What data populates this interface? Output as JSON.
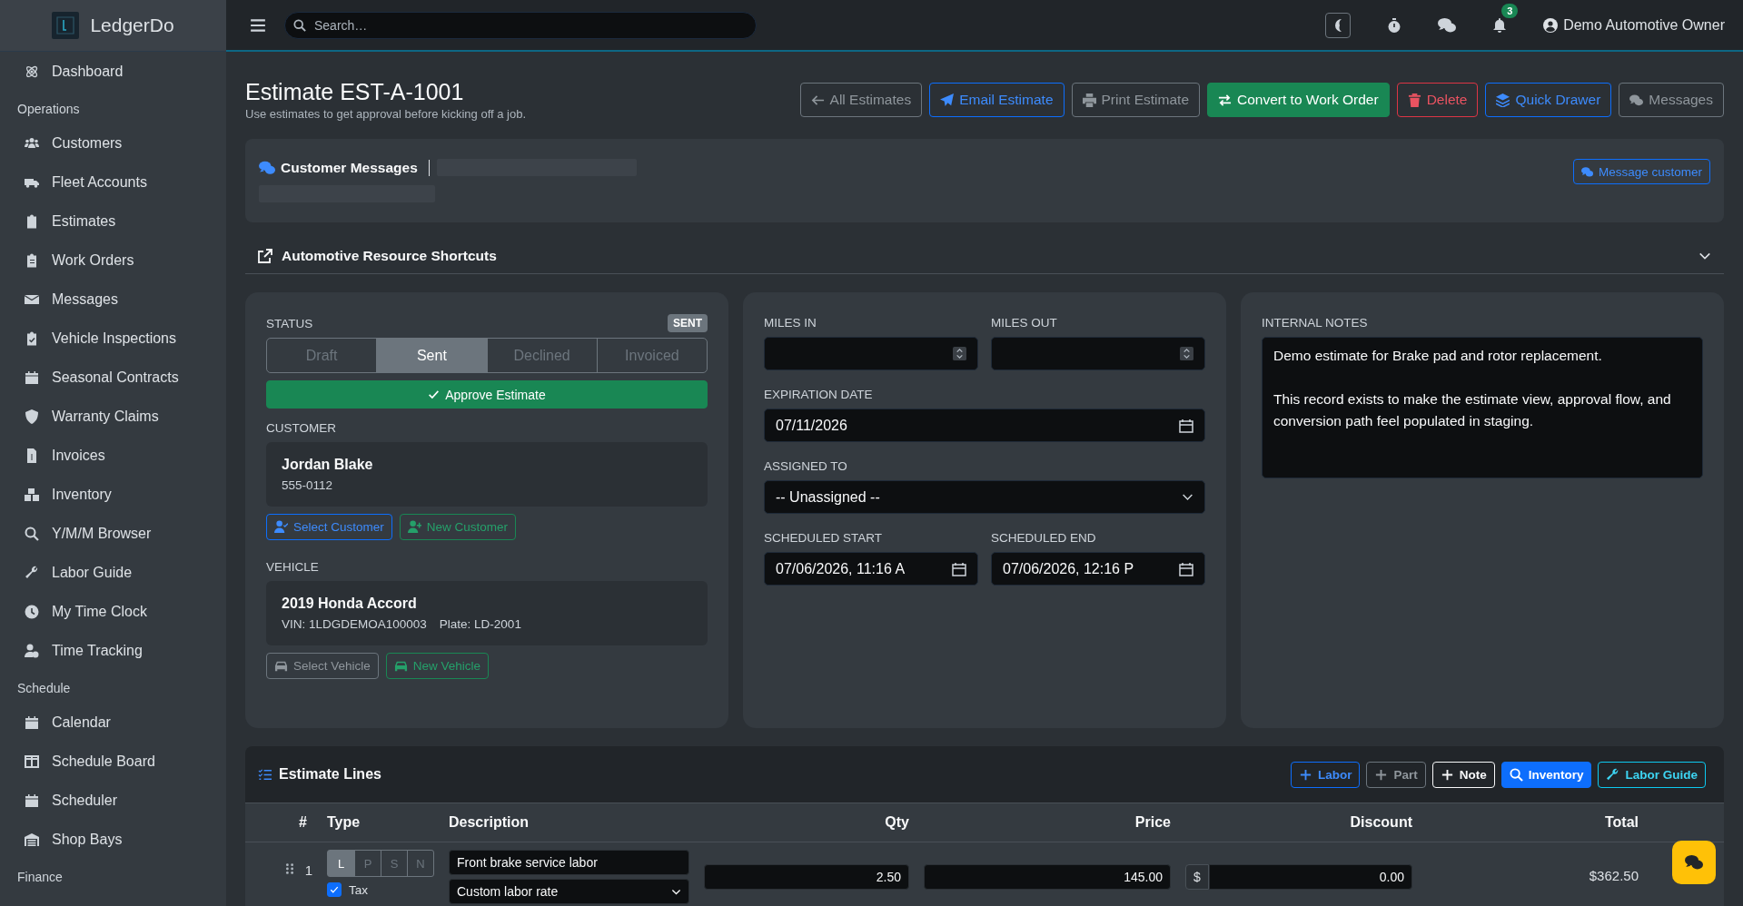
{
  "brand": {
    "name": "LedgerDo"
  },
  "topbar": {
    "search_placeholder": "Search…",
    "notification_count": "3",
    "user": "Demo Automotive Owner"
  },
  "sidebar": {
    "items": [
      {
        "kind": "item",
        "label": "Dashboard"
      },
      {
        "kind": "section",
        "label": "Operations"
      },
      {
        "kind": "item",
        "label": "Customers"
      },
      {
        "kind": "item",
        "label": "Fleet Accounts"
      },
      {
        "kind": "item",
        "label": "Estimates"
      },
      {
        "kind": "item",
        "label": "Work Orders"
      },
      {
        "kind": "item",
        "label": "Messages"
      },
      {
        "kind": "item",
        "label": "Vehicle Inspections"
      },
      {
        "kind": "item",
        "label": "Seasonal Contracts"
      },
      {
        "kind": "item",
        "label": "Warranty Claims"
      },
      {
        "kind": "item",
        "label": "Invoices"
      },
      {
        "kind": "item",
        "label": "Inventory"
      },
      {
        "kind": "item",
        "label": "Y/M/M Browser"
      },
      {
        "kind": "item",
        "label": "Labor Guide"
      },
      {
        "kind": "item",
        "label": "My Time Clock"
      },
      {
        "kind": "item",
        "label": "Time Tracking"
      },
      {
        "kind": "section",
        "label": "Schedule"
      },
      {
        "kind": "item",
        "label": "Calendar"
      },
      {
        "kind": "item",
        "label": "Schedule Board"
      },
      {
        "kind": "item",
        "label": "Scheduler"
      },
      {
        "kind": "item",
        "label": "Shop Bays"
      },
      {
        "kind": "section",
        "label": "Finance"
      }
    ]
  },
  "page": {
    "title": "Estimate EST-A-1001",
    "subtitle": "Use estimates to get approval before kicking off a job.",
    "actions": [
      "All Estimates",
      "Email Estimate",
      "Print Estimate",
      "Convert to Work Order",
      "Delete",
      "Quick Drawer",
      "Messages"
    ]
  },
  "customer_messages": {
    "title": "Customer Messages",
    "button": "Message customer"
  },
  "shortcuts": {
    "title": "Automotive Resource Shortcuts",
    "expanded": false
  },
  "status": {
    "label": "STATUS",
    "badge": "SENT",
    "options": [
      {
        "label": "Draft",
        "selected": false
      },
      {
        "label": "Sent",
        "selected": true
      },
      {
        "label": "Declined",
        "selected": false
      },
      {
        "label": "Invoiced",
        "selected": false
      }
    ],
    "approve_button": "Approve Estimate"
  },
  "customer": {
    "label": "CUSTOMER",
    "name": "Jordan Blake",
    "phone": "555-0112",
    "buttons": [
      "Select Customer",
      "New Customer"
    ]
  },
  "vehicle": {
    "label": "VEHICLE",
    "name": "2019 Honda Accord",
    "vin": "VIN: 1LDGDEMOA100003",
    "plate": "Plate: LD-2001",
    "buttons": [
      "Select Vehicle",
      "New Vehicle"
    ]
  },
  "details": {
    "miles_in": {
      "label": "MILES IN"
    },
    "miles_out": {
      "label": "MILES OUT"
    },
    "expiration_date": {
      "label": "EXPIRATION DATE",
      "value": "07/11/2026"
    },
    "assigned_to": {
      "label": "ASSIGNED TO",
      "value": "-- Unassigned --"
    },
    "scheduled_start": {
      "label": "SCHEDULED START",
      "value": "07/06/2026, 11:16 A"
    },
    "scheduled_end": {
      "label": "SCHEDULED END",
      "value": "07/06/2026, 12:16 P"
    }
  },
  "notes": {
    "label": "INTERNAL NOTES",
    "value": "Demo estimate for Brake pad and rotor replacement.\n\nThis record exists to make the estimate view, approval flow, and conversion path feel populated in staging."
  },
  "lines": {
    "title": "Estimate Lines",
    "buttons": [
      "Labor",
      "Part",
      "Note",
      "Inventory",
      "Labor Guide"
    ],
    "columns": [
      "#",
      "Type",
      "Description",
      "Qty",
      "Price",
      "Discount",
      "Total"
    ],
    "rows": [
      {
        "number": "1",
        "types": [
          {
            "label": "L",
            "selected": true
          },
          {
            "label": "P",
            "selected": false
          },
          {
            "label": "S",
            "selected": false
          },
          {
            "label": "N",
            "selected": false
          }
        ],
        "tax_label": "Tax",
        "tax": true,
        "description": "Front brake service labor",
        "rate": "Custom labor rate",
        "qty": "2.50",
        "price": "145.00",
        "discount_prefix": "$",
        "discount": "0.00",
        "total": "$362.50"
      }
    ]
  }
}
